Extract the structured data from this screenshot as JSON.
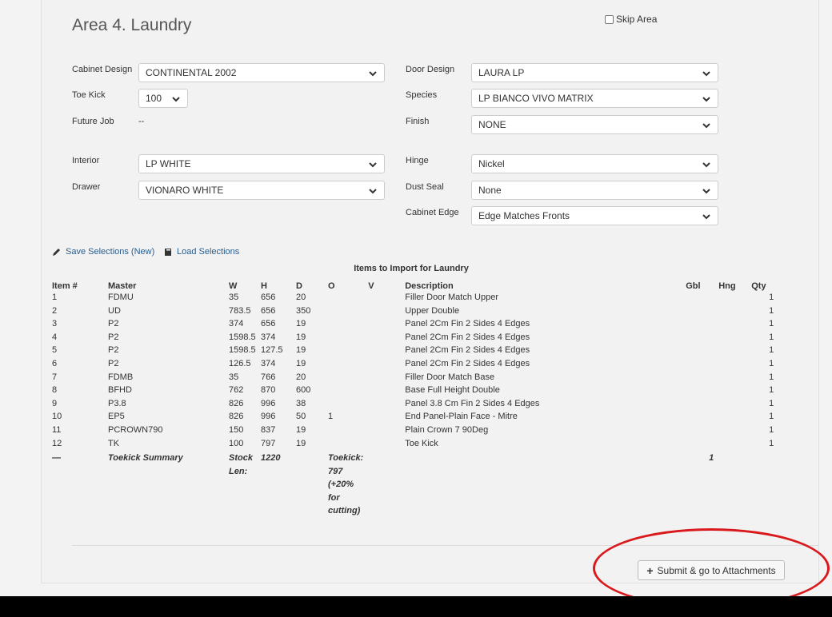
{
  "area": {
    "title": "Area 4. Laundry",
    "skip_label": "Skip Area"
  },
  "fields": {
    "cabinet_design": {
      "label": "Cabinet Design",
      "value": "CONTINENTAL 2002"
    },
    "door_design": {
      "label": "Door Design",
      "value": "LAURA LP"
    },
    "toe_kick": {
      "label": "Toe Kick",
      "value": "100"
    },
    "species": {
      "label": "Species",
      "value": "LP BIANCO VIVO MATRIX"
    },
    "future_job": {
      "label": "Future Job",
      "value": "--"
    },
    "finish": {
      "label": "Finish",
      "value": "NONE"
    },
    "interior": {
      "label": "Interior",
      "value": "LP WHITE"
    },
    "hinge": {
      "label": "Hinge",
      "value": "Nickel"
    },
    "drawer": {
      "label": "Drawer",
      "value": "VIONARO WHITE"
    },
    "dust_seal": {
      "label": "Dust Seal",
      "value": "None"
    },
    "cabinet_edge": {
      "label": "Cabinet Edge",
      "value": "Edge Matches Fronts"
    }
  },
  "actions": {
    "save_label": "Save Selections (New)",
    "load_label": "Load Selections"
  },
  "table": {
    "caption": "Items to Import for Laundry",
    "headers": {
      "item": "Item #",
      "master": "Master",
      "w": "W",
      "h": "H",
      "d": "D",
      "o": "O",
      "v": "V",
      "desc": "Description",
      "gbl": "Gbl",
      "hng": "Hng",
      "qty": "Qty"
    },
    "rows": [
      {
        "item": "1",
        "master": "FDMU",
        "w": "35",
        "h": "656",
        "d": "20",
        "o": "",
        "v": "",
        "desc": "Filler Door Match Upper",
        "gbl": "",
        "hng": "",
        "qty": "1"
      },
      {
        "item": "2",
        "master": "UD",
        "w": "783.5",
        "h": "656",
        "d": "350",
        "o": "",
        "v": "",
        "desc": "Upper Double",
        "gbl": "",
        "hng": "",
        "qty": "1"
      },
      {
        "item": "3",
        "master": "P2",
        "w": "374",
        "h": "656",
        "d": "19",
        "o": "",
        "v": "",
        "desc": "Panel 2Cm Fin 2 Sides 4 Edges",
        "gbl": "",
        "hng": "",
        "qty": "1"
      },
      {
        "item": "4",
        "master": "P2",
        "w": "1598.5",
        "h": "374",
        "d": "19",
        "o": "",
        "v": "",
        "desc": "Panel 2Cm Fin 2 Sides 4 Edges",
        "gbl": "",
        "hng": "",
        "qty": "1"
      },
      {
        "item": "5",
        "master": "P2",
        "w": "1598.5",
        "h": "127.5",
        "d": "19",
        "o": "",
        "v": "",
        "desc": "Panel 2Cm Fin 2 Sides 4 Edges",
        "gbl": "",
        "hng": "",
        "qty": "1"
      },
      {
        "item": "6",
        "master": "P2",
        "w": "126.5",
        "h": "374",
        "d": "19",
        "o": "",
        "v": "",
        "desc": "Panel 2Cm Fin 2 Sides 4 Edges",
        "gbl": "",
        "hng": "",
        "qty": "1"
      },
      {
        "item": "7",
        "master": "FDMB",
        "w": "35",
        "h": "766",
        "d": "20",
        "o": "",
        "v": "",
        "desc": "Filler Door Match Base",
        "gbl": "",
        "hng": "",
        "qty": "1"
      },
      {
        "item": "8",
        "master": "BFHD",
        "w": "762",
        "h": "870",
        "d": "600",
        "o": "",
        "v": "",
        "desc": "Base Full Height Double",
        "gbl": "",
        "hng": "",
        "qty": "1"
      },
      {
        "item": "9",
        "master": "P3.8",
        "w": "826",
        "h": "996",
        "d": "38",
        "o": "",
        "v": "",
        "desc": "Panel 3.8 Cm Fin 2 Sides 4 Edges",
        "gbl": "",
        "hng": "",
        "qty": "1"
      },
      {
        "item": "10",
        "master": "EP5",
        "w": "826",
        "h": "996",
        "d": "50",
        "o": "1",
        "v": "",
        "desc": "End Panel-Plain Face - Mitre",
        "gbl": "",
        "hng": "",
        "qty": "1"
      },
      {
        "item": "11",
        "master": "PCROWN790",
        "w": "150",
        "h": "837",
        "d": "19",
        "o": "",
        "v": "",
        "desc": "Plain Crown 7 90Deg",
        "gbl": "",
        "hng": "",
        "qty": "1"
      },
      {
        "item": "12",
        "master": "TK",
        "w": "100",
        "h": "797",
        "d": "19",
        "o": "",
        "v": "",
        "desc": "Toe Kick",
        "gbl": "",
        "hng": "",
        "qty": "1"
      }
    ],
    "summary": {
      "item": "—",
      "master": "Toekick Summary",
      "w": "Stock Len:",
      "h": "1220",
      "o": "Toekick: 797 (+20% for cutting)",
      "gbl": "1"
    }
  },
  "submit": {
    "label": "Submit & go to Attachments"
  }
}
